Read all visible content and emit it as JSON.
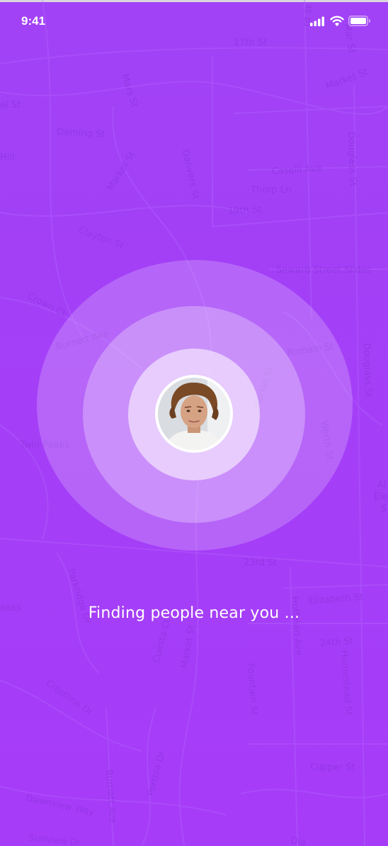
{
  "status_bar": {
    "time": "9:41",
    "icons": [
      "signal-icon",
      "wifi-icon",
      "battery-icon"
    ]
  },
  "map": {
    "street_labels": [
      "17th St",
      "Market St",
      "el St",
      "Mars St",
      "Deming St",
      "Douglass St",
      "Hill",
      "Market St",
      "Danvers St",
      "Caselli Ave",
      "Thorp Ln",
      "19th St",
      "Clayton St",
      "Seward Street Slides",
      "Crown Ct",
      "Burnett Ave",
      "Romain St",
      "Douglass St",
      "Market St",
      "Worth St",
      "Twin Peaks",
      "Al",
      "Ele",
      "S",
      "23rd St",
      "Parkridge Dr",
      "Elizabeth St",
      "eaks",
      "Cuesta Ct",
      "Market St",
      "Hoffman Ave",
      "24th St",
      "Homestead St",
      "Fountain St",
      "Crestline Dr",
      "Clipper St",
      "Portola Dr",
      "Burnett Ave",
      "Dawnview Way",
      "Sunview Dr",
      "Dia",
      "rd St",
      "Mar St"
    ]
  },
  "search": {
    "status_text": "Finding people near you ..."
  },
  "colors": {
    "background": "#a43ff7",
    "map_text": "#8a2fd9",
    "ring_outer": "rgba(255,255,255,0.20)",
    "ring_middle": "rgba(255,255,255,0.28)",
    "ring_inner": "rgba(255,255,255,0.55)"
  }
}
